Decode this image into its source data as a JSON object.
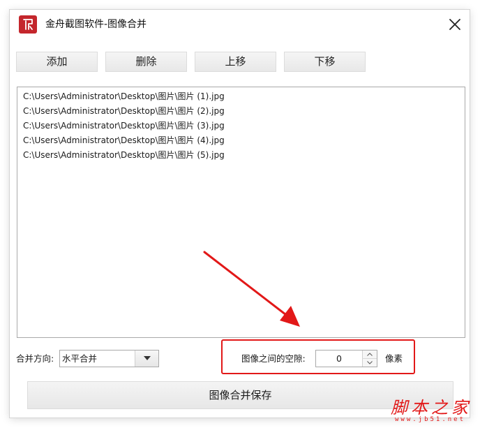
{
  "window": {
    "title": "金舟截图软件-图像合并"
  },
  "toolbar": {
    "add_label": "添加",
    "delete_label": "删除",
    "move_up_label": "上移",
    "move_down_label": "下移"
  },
  "file_list": {
    "items": [
      "C:\\Users\\Administrator\\Desktop\\图片\\图片 (1).jpg",
      "C:\\Users\\Administrator\\Desktop\\图片\\图片 (2).jpg",
      "C:\\Users\\Administrator\\Desktop\\图片\\图片 (3).jpg",
      "C:\\Users\\Administrator\\Desktop\\图片\\图片 (4).jpg",
      "C:\\Users\\Administrator\\Desktop\\图片\\图片 (5).jpg"
    ]
  },
  "options": {
    "direction_label": "合并方向:",
    "direction_value": "水平合并",
    "gap_label": "图像之间的空隙:",
    "gap_value": "0",
    "gap_unit": "像素"
  },
  "actions": {
    "save_label": "图像合并保存"
  },
  "watermark": {
    "text": "脚本之家",
    "url": "www.jb51.net"
  },
  "colors": {
    "annotation": "#e21818",
    "app_icon": "#c4262c"
  },
  "icons": {
    "app": "jinzhou-app-icon",
    "close": "close-icon",
    "dropdown": "chevron-down-icon",
    "spin_up": "spin-up-icon",
    "spin_down": "spin-down-icon"
  }
}
